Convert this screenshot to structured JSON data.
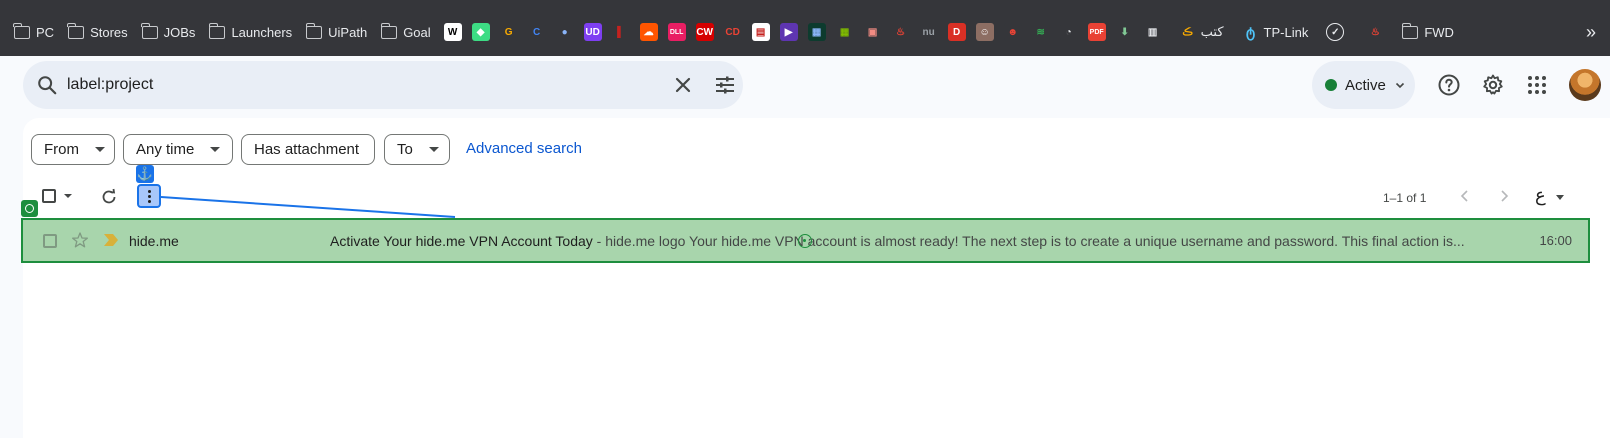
{
  "bookmarks": {
    "folders_left": [
      "PC",
      "Stores",
      "JOBs",
      "Launchers",
      "UiPath",
      "Goal"
    ],
    "arabic_label": "كتب",
    "tplink_label": "TP-Link",
    "fwd_label": "FWD",
    "favicons": [
      {
        "name": "wikipedia-favicon",
        "glyph": "W",
        "bg": "#ffffff",
        "fg": "#000000"
      },
      {
        "name": "android-favicon",
        "glyph": "◆",
        "bg": "#3ddc84",
        "fg": "#ffffff"
      },
      {
        "name": "g-favicon",
        "glyph": "G",
        "bg": "#35363a",
        "fg": "#f9ab00"
      },
      {
        "name": "chrome-favicon",
        "glyph": "C",
        "bg": "#35363a",
        "fg": "#4285f4"
      },
      {
        "name": "drop-favicon",
        "glyph": "●",
        "bg": "#35363a",
        "fg": "#8ab4f8"
      },
      {
        "name": "purple-app-favicon",
        "glyph": "UD",
        "bg": "#7e3ff2",
        "fg": "#ffffff"
      },
      {
        "name": "red-app-favicon",
        "glyph": "▌",
        "bg": "#35363a",
        "fg": "#c5221f"
      },
      {
        "name": "soundcloud-favicon",
        "glyph": "☁",
        "bg": "#ff5500",
        "fg": "#ffffff"
      },
      {
        "name": "dll-favicon",
        "glyph": "DLL",
        "bg": "#e91e63",
        "fg": "#ffffff"
      },
      {
        "name": "cw-favicon",
        "glyph": "CW",
        "bg": "#d50000",
        "fg": "#ffffff"
      },
      {
        "name": "cd-favicon",
        "glyph": "CD",
        "bg": "#35363a",
        "fg": "#ea4335"
      },
      {
        "name": "chart-favicon",
        "glyph": "▤",
        "bg": "#ffffff",
        "fg": "#c5221f"
      },
      {
        "name": "video-favicon",
        "glyph": "▶",
        "bg": "#5e35b1",
        "fg": "#ffffff"
      },
      {
        "name": "terminal-favicon",
        "glyph": "▦",
        "bg": "#0d3b2e",
        "fg": "#8ab4f8"
      },
      {
        "name": "microsoft-favicon",
        "glyph": "▦",
        "bg": "#35363a",
        "fg": "#7fba00"
      },
      {
        "name": "gamepad-favicon",
        "glyph": "▣",
        "bg": "#35363a",
        "fg": "#f28b82"
      },
      {
        "name": "flame-app-favicon",
        "glyph": "♨",
        "bg": "#35363a",
        "fg": "#ea4335"
      },
      {
        "name": "nu-favicon",
        "glyph": "nu",
        "bg": "#35363a",
        "fg": "#9aa0a6"
      },
      {
        "name": "d-favicon",
        "glyph": "D",
        "bg": "#d93025",
        "fg": "#ffffff"
      },
      {
        "name": "portrait-favicon",
        "glyph": "☺",
        "bg": "#8d6e63",
        "fg": "#ffffff"
      },
      {
        "name": "face-favicon",
        "glyph": "☻",
        "bg": "#35363a",
        "fg": "#ea4335"
      },
      {
        "name": "rainbow-favicon",
        "glyph": "≋",
        "bg": "#35363a",
        "fg": "#34a853"
      },
      {
        "name": "speedometer-favicon",
        "glyph": "◔",
        "bg": "#35363a",
        "fg": "#e8eaed"
      },
      {
        "name": "pdf-favicon",
        "glyph": "PDF",
        "bg": "#e94235",
        "fg": "#ffffff"
      },
      {
        "name": "download-favicon",
        "glyph": "⬇",
        "bg": "#35363a",
        "fg": "#81c995"
      },
      {
        "name": "archive-favicon",
        "glyph": "▥",
        "bg": "#35363a",
        "fg": "#e8eaed"
      }
    ]
  },
  "search": {
    "query": "label:project"
  },
  "status": {
    "label": "Active",
    "color": "#188038"
  },
  "filters": {
    "from": "From",
    "any_time": "Any time",
    "has_attachment": "Has attachment",
    "to": "To",
    "advanced": "Advanced search"
  },
  "toolbar": {
    "pager": "1–1 of 1",
    "lang": "ع"
  },
  "email": {
    "sender": "hide.me",
    "subject": "Activate Your hide.me VPN Account Today",
    "snippet": " - hide.me logo Your hide.me VPN account is almost ready! The next step is to create a unique username and password. This final action is...",
    "time": "16:00"
  },
  "colors": {
    "accent": "#0b57d0",
    "selection_fill": "#a8d5ac",
    "selection_border": "#1e8e3e",
    "annotation_blue": "#1a73e8"
  }
}
